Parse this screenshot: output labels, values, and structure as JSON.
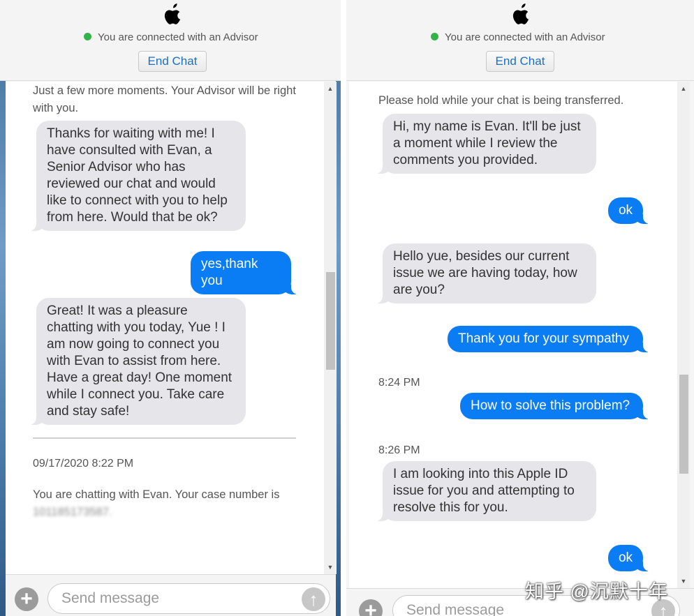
{
  "left": {
    "header": {
      "status": "You are connected with an Advisor",
      "end_chat": "End Chat"
    },
    "messages": {
      "sys1": "Just a few more moments. Your Advisor will be right with you.",
      "m1": "Thanks for waiting with me! I have consulted with Evan, a Senior Advisor who has reviewed our chat and would like to connect with you to help from here. Would that be ok?",
      "m2": "yes,thank you",
      "m3": "Great! It was a pleasure chatting with you today, Yue ! I am now going to connect you with Evan to assist from here. Have a great day! One moment while I connect you. Take care and stay safe!",
      "timestamp": "09/17/2020 8:22 PM",
      "case_text": "You are chatting with Evan. Your case number is",
      "case_number": "101185173587."
    },
    "input": {
      "placeholder": "Send message"
    }
  },
  "right": {
    "header": {
      "status": "You are connected with an Advisor",
      "end_chat": "End Chat"
    },
    "messages": {
      "sys1": "Please hold while your chat is being transferred.",
      "m1": "Hi, my name is Evan. It'll be just a moment while I review the comments you provided.",
      "m2": "ok",
      "m3": "Hello yue, besides our current issue we are having today, how are you?",
      "m4": "Thank you for your sympathy",
      "t1": "8:24 PM",
      "m5": "How to solve this problem?",
      "t2": "8:26 PM",
      "m6": "I am looking into this Apple ID issue for you and attempting to resolve this for you.",
      "m7": "ok"
    },
    "input": {
      "placeholder": "Send message"
    }
  },
  "watermark": "知乎 @沉默十年",
  "icons": [
    "apple-logo-icon",
    "plus-icon",
    "send-arrow-icon",
    "scroll-up-icon",
    "scroll-down-icon"
  ],
  "colors": {
    "outgoing_bubble": "#0a7cf4",
    "incoming_bubble": "#e5e5ea",
    "online_dot": "#32b34a",
    "end_chat_text": "#1e6fbf"
  }
}
